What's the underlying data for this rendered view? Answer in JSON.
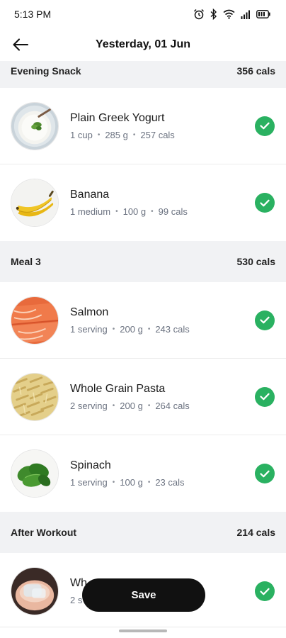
{
  "status_bar": {
    "time": "5:13 PM"
  },
  "header": {
    "title": "Yesterday, 01 Jun"
  },
  "sections": [
    {
      "title": "Evening Snack",
      "calories": "356 cals",
      "items": [
        {
          "name": "Plain Greek Yogurt",
          "quantity": "1 cup",
          "weight": "285 g",
          "calories": "257 cals",
          "image": "greek-yogurt"
        },
        {
          "name": "Banana",
          "quantity": "1 medium",
          "weight": "100 g",
          "calories": "99 cals",
          "image": "banana"
        }
      ]
    },
    {
      "title": "Meal 3",
      "calories": "530 cals",
      "items": [
        {
          "name": "Salmon",
          "quantity": "1 serving",
          "weight": "200 g",
          "calories": "243 cals",
          "image": "salmon"
        },
        {
          "name": "Whole Grain Pasta",
          "quantity": "2 serving",
          "weight": "200 g",
          "calories": "264 cals",
          "image": "pasta"
        },
        {
          "name": "Spinach",
          "quantity": "1 serving",
          "weight": "100 g",
          "calories": "23 cals",
          "image": "spinach"
        }
      ]
    },
    {
      "title": "After Workout",
      "calories": "214 cals",
      "items": [
        {
          "name": "Wh",
          "quantity": "2 s",
          "image": "protein-shake"
        }
      ]
    }
  ],
  "save_button": {
    "label": "Save"
  },
  "colors": {
    "check_green": "#2ab161",
    "section_bg": "#f1f2f4",
    "button_bg": "#111111"
  },
  "icons": [
    "alarm-icon",
    "bluetooth-icon",
    "wifi-icon",
    "signal-icon",
    "battery-icon",
    "back-arrow-icon",
    "check-icon"
  ]
}
